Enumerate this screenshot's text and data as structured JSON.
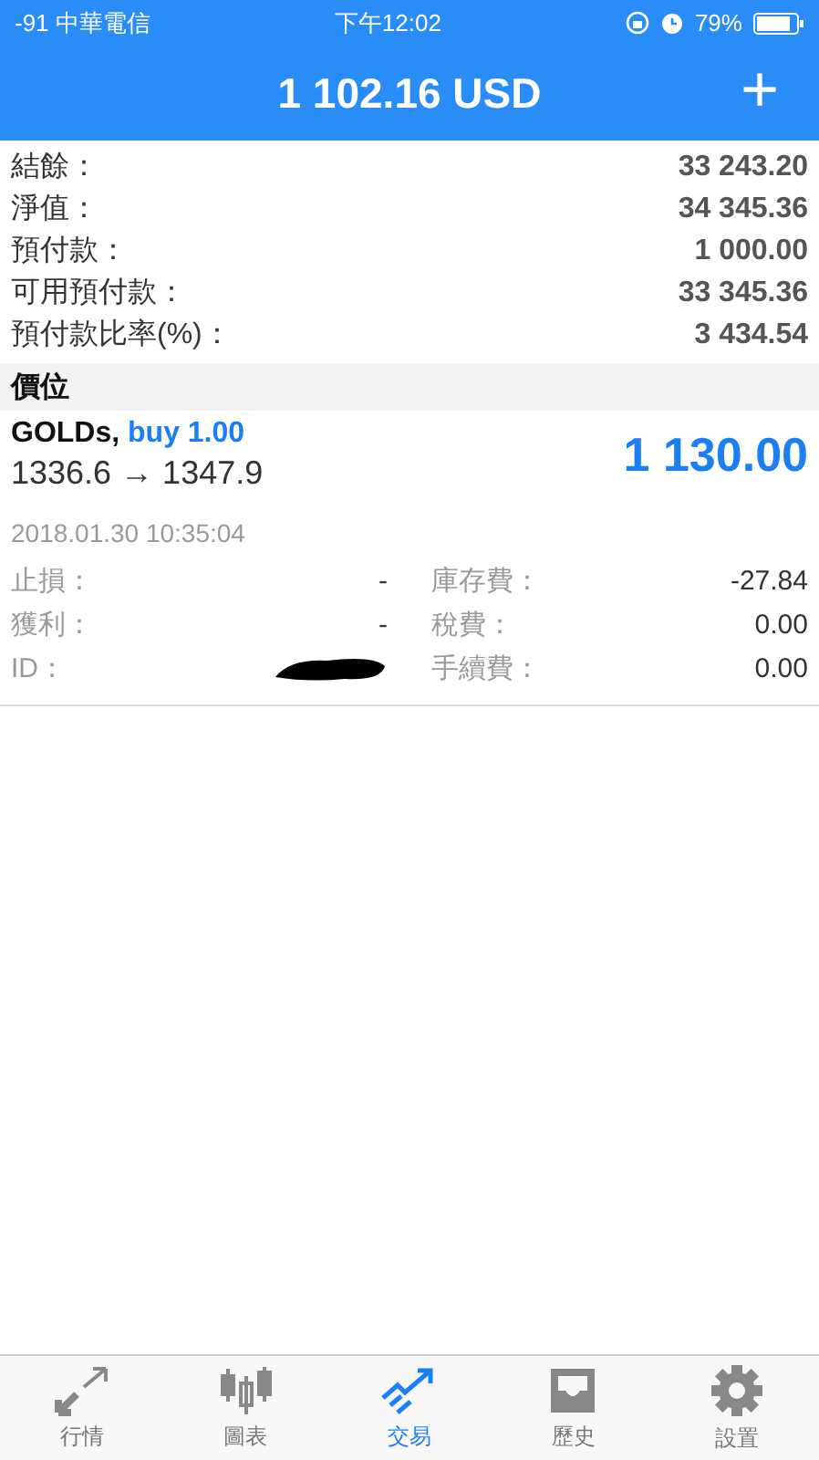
{
  "status_bar": {
    "carrier": "-91 中華電信",
    "time": "下午12:02",
    "battery": "79%"
  },
  "header": {
    "title": "1 102.16 USD",
    "add_button": "+"
  },
  "summary": [
    {
      "label": "結餘：",
      "value": "33 243.20"
    },
    {
      "label": "淨值：",
      "value": "34 345.36"
    },
    {
      "label": "預付款：",
      "value": "1 000.00"
    },
    {
      "label": "可用預付款：",
      "value": "33 345.36"
    },
    {
      "label": "預付款比率(%)：",
      "value": "3 434.54"
    }
  ],
  "section_title": "價位",
  "positions": [
    {
      "symbol": "GOLDs,",
      "side": "buy 1.00",
      "prices": "1336.6 → 1347.9",
      "profit": "1 130.00",
      "time": "2018.01.30 10:35:04",
      "details": [
        {
          "label": "止損：",
          "value": "-",
          "label2": "庫存費：",
          "value2": "-27.84"
        },
        {
          "label": "獲利：",
          "value": "-",
          "label2": "稅費：",
          "value2": "0.00"
        },
        {
          "label": "ID：",
          "redacted": true,
          "label2": "手續費：",
          "value2": "0.00"
        }
      ]
    }
  ],
  "tabs": [
    {
      "label": "行情",
      "kind": "arrows",
      "selected": false
    },
    {
      "label": "圖表",
      "kind": "candles",
      "selected": false
    },
    {
      "label": "交易",
      "kind": "trend",
      "selected": true
    },
    {
      "label": "歷史",
      "kind": "inbox",
      "selected": false
    },
    {
      "label": "設置",
      "kind": "gear",
      "selected": false
    }
  ]
}
